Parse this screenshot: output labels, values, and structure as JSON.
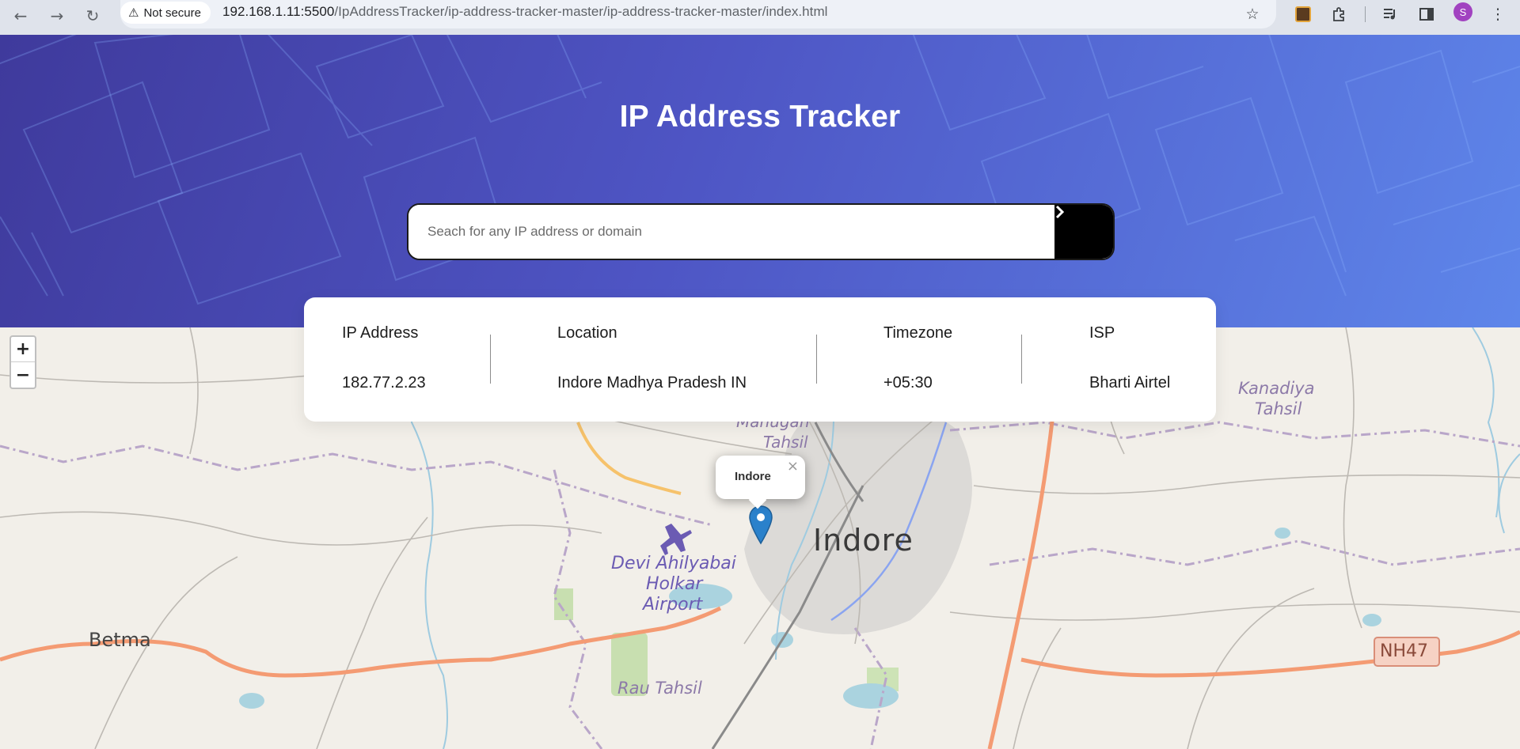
{
  "browser": {
    "security_label": "Not secure",
    "url_host": "192.168.1.11:5500",
    "url_path": "/IpAddressTracker/ip-address-tracker-master/ip-address-tracker-master/index.html",
    "avatar_letter": "S"
  },
  "header": {
    "title": "IP Address Tracker"
  },
  "search": {
    "placeholder": "Seach for any IP address or domain",
    "value": ""
  },
  "info": {
    "ip_label": "IP Address",
    "ip_value": "182.77.2.23",
    "location_label": "Location",
    "location_value": "Indore Madhya Pradesh IN",
    "timezone_label": "Timezone",
    "timezone_value": "+05:30",
    "isp_label": "ISP",
    "isp_value": "Bharti Airtel"
  },
  "map": {
    "zoom_in": "+",
    "zoom_out": "−",
    "popup_text": "Indore",
    "popup_close": "×",
    "labels": {
      "city": "Indore",
      "betma": "Betma",
      "airport_1": "Devi Ahilyabai",
      "airport_2": "Holkar",
      "airport_3": "Airport",
      "rau": "Rau Tahsil",
      "kanadiya_1": "Kanadiya",
      "kanadiya_2": "Tahsil",
      "mahu_1": "Mahugan",
      "mahu_2": "Tahsil",
      "highway": "NH47"
    }
  },
  "colors": {
    "hero_start": "#3f3a9c",
    "hero_end": "#5e86ea",
    "marker": "#2a81cb",
    "road": "#f49b73"
  }
}
